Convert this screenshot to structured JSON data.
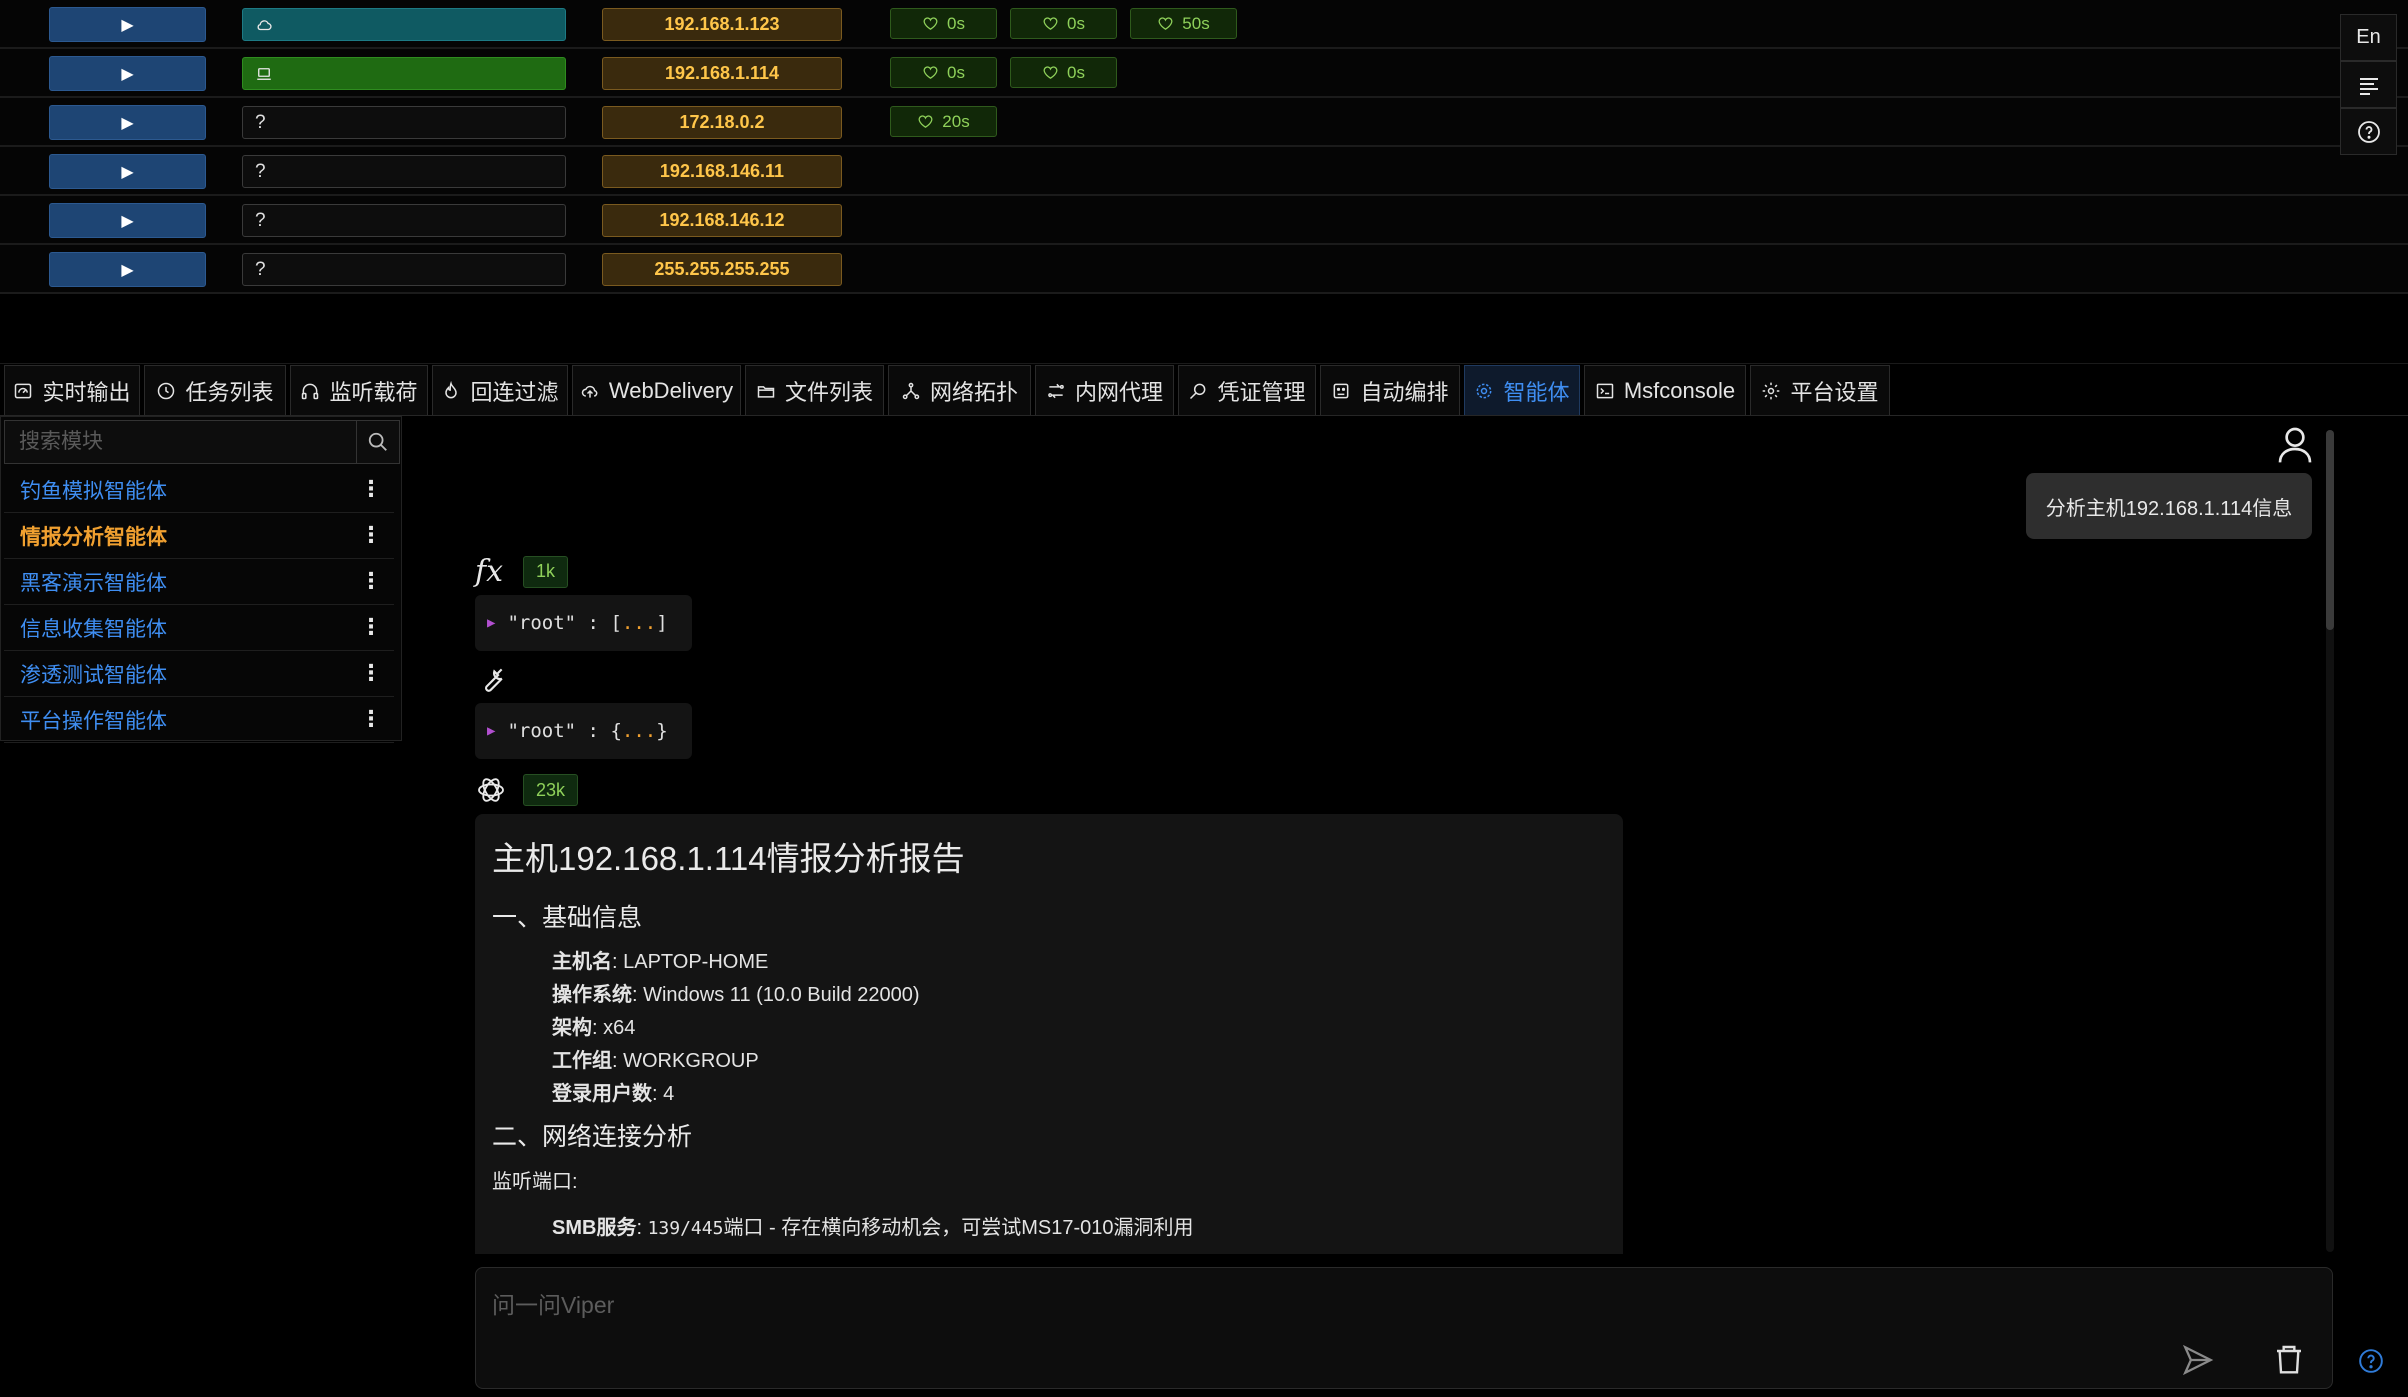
{
  "hosts": [
    {
      "os": "cloud",
      "os_label": "",
      "ip": "192.168.1.123",
      "heartbeats": [
        "0s",
        "0s",
        "50s"
      ]
    },
    {
      "os": "laptop",
      "os_label": "",
      "ip": "192.168.1.114",
      "heartbeats": [
        "0s",
        "0s"
      ]
    },
    {
      "os": "unknown",
      "os_label": "?",
      "ip": "172.18.0.2",
      "heartbeats": [
        "20s"
      ]
    },
    {
      "os": "unknown",
      "os_label": "?",
      "ip": "192.168.146.11",
      "heartbeats": []
    },
    {
      "os": "unknown",
      "os_label": "?",
      "ip": "192.168.146.12",
      "heartbeats": []
    },
    {
      "os": "unknown",
      "os_label": "?",
      "ip": "255.255.255.255",
      "heartbeats": []
    }
  ],
  "side_buttons": {
    "language": "En"
  },
  "tabs": [
    {
      "label": "实时输出",
      "icon": "dashboard-icon"
    },
    {
      "label": "任务列表",
      "icon": "clock-icon"
    },
    {
      "label": "监听载荷",
      "icon": "headphones-icon"
    },
    {
      "label": "回连过滤",
      "icon": "fire-icon"
    },
    {
      "label": "WebDelivery",
      "icon": "cloud-upload-icon"
    },
    {
      "label": "文件列表",
      "icon": "folder-icon"
    },
    {
      "label": "网络拓扑",
      "icon": "topology-icon"
    },
    {
      "label": "内网代理",
      "icon": "proxy-icon"
    },
    {
      "label": "凭证管理",
      "icon": "key-search-icon"
    },
    {
      "label": "自动编排",
      "icon": "robot-icon"
    },
    {
      "label": "智能体",
      "icon": "agent-icon",
      "active": true
    },
    {
      "label": "Msfconsole",
      "icon": "terminal-icon"
    },
    {
      "label": "平台设置",
      "icon": "gear-icon"
    }
  ],
  "sidebar": {
    "search_placeholder": "搜索模块",
    "agents": [
      {
        "label": "钓鱼模拟智能体"
      },
      {
        "label": "情报分析智能体",
        "active": true
      },
      {
        "label": "黑客演示智能体"
      },
      {
        "label": "信息收集智能体"
      },
      {
        "label": "渗透测试智能体"
      },
      {
        "label": "平台操作智能体"
      }
    ]
  },
  "chat": {
    "user_message": "分析主机192.168.1.114信息",
    "function_tokens": "1k",
    "function_json": {
      "key": "\"root\"",
      "colon": ":",
      "open": "[",
      "dots": "...",
      "close": "]"
    },
    "tool_json": {
      "key": "\"root\"",
      "colon": ":",
      "open": "{",
      "dots": "...",
      "close": "}"
    },
    "answer_tokens": "23k",
    "report": {
      "title": "主机192.168.1.114情报分析报告",
      "section1": "一、基础信息",
      "basic": [
        {
          "k": "主机名",
          "v": ": LAPTOP-HOME"
        },
        {
          "k": "操作系统",
          "v": ": Windows 11 (10.0 Build 22000)"
        },
        {
          "k": "架构",
          "v": ": x64"
        },
        {
          "k": "工作组",
          "v": ": WORKGROUP"
        },
        {
          "k": "登录用户数",
          "v": ": 4"
        }
      ],
      "section2": "二、网络连接分析",
      "listen_label": "监听端口:",
      "smb_key": "SMB服务",
      "smb_sep": ": ",
      "smb_ports": "139/445",
      "smb_text": "端口 - 存在横向移动机会，可尝试MS17-010漏洞利用"
    }
  },
  "composer": {
    "placeholder": "问一问Viper"
  }
}
